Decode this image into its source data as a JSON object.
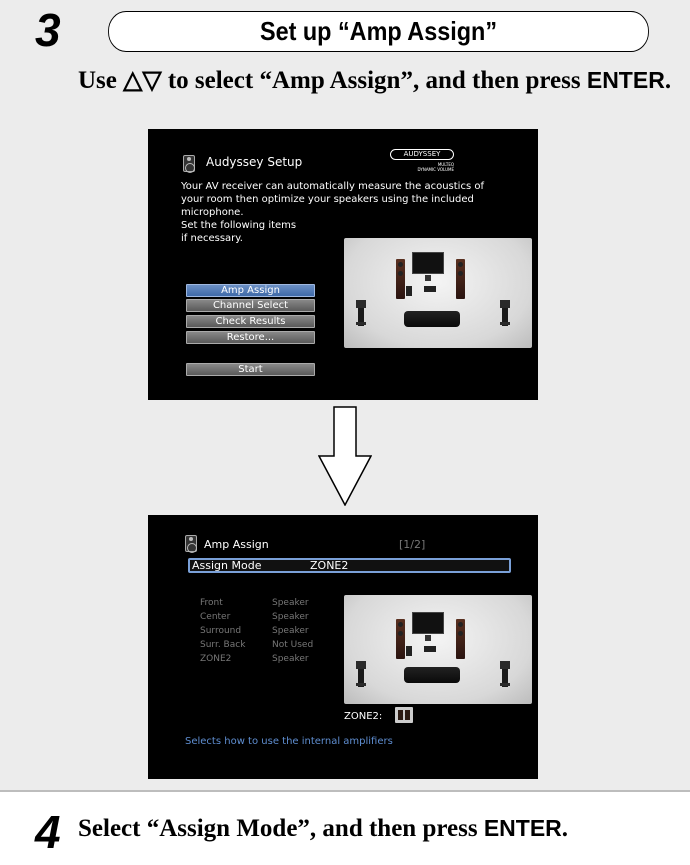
{
  "step3": {
    "number": "3",
    "title": "Set up “Amp Assign”",
    "instruction_prefix": "Use △▽ to select “Amp Assign”, and then press",
    "instruction_key": "ENTER",
    "instruction_suffix": "."
  },
  "screen1": {
    "header": "Audyssey Setup",
    "logo": "AUDYSSEY",
    "logo_sub1": "MULTEQ",
    "logo_sub2": "DYNAMIC VOLUME",
    "description": [
      "Your AV receiver can automatically measure the acoustics of",
      "your room then optimize your speakers using the included",
      "microphone.",
      "Set the following items",
      "if necessary."
    ],
    "buttons": [
      "Amp Assign",
      "Channel Select",
      "Check Results",
      "Restore..."
    ],
    "start_button": "Start"
  },
  "screen2": {
    "header": "Amp Assign",
    "page": "[1/2]",
    "mode_label": "Assign Mode",
    "mode_value": "ZONE2",
    "rows": [
      {
        "name": "Front",
        "value": "Speaker"
      },
      {
        "name": "Center",
        "value": "Speaker"
      },
      {
        "name": "Surround",
        "value": "Speaker"
      },
      {
        "name": "Surr. Back",
        "value": "Not Used"
      },
      {
        "name": "ZONE2",
        "value": "Speaker"
      }
    ],
    "zone_label": "ZONE2:",
    "help_text": "Selects how to use the internal amplifiers"
  },
  "step4": {
    "number": "4",
    "text_prefix": "Select “Assign Mode”, and then press",
    "text_key": "ENTER",
    "text_suffix": "."
  },
  "colors": {
    "highlight_blue": "#5f8ed1",
    "page_gray": "#ececec"
  }
}
